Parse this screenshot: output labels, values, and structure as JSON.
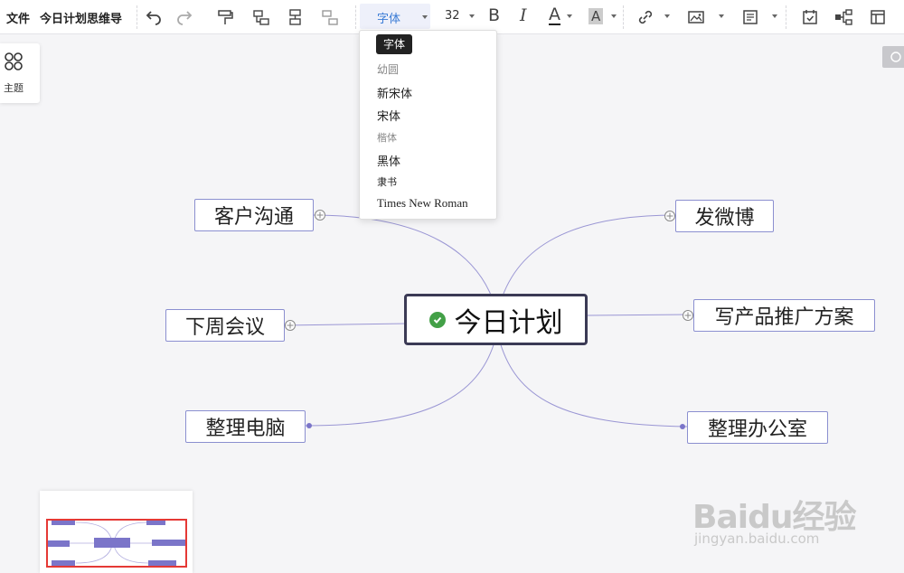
{
  "toolbar": {
    "file_menu": "文件",
    "doc_title": "今日计划思维导",
    "font_family": "字体",
    "font_size": "32",
    "bold_glyph": "B",
    "italic_glyph": "I",
    "font_color_glyph": "A",
    "highlight_glyph": "A"
  },
  "font_dropdown": {
    "tooltip": "字体",
    "options": [
      "幼圆",
      "新宋体",
      "宋体",
      "楷体",
      "黑体",
      "隶书",
      "Times New Roman"
    ]
  },
  "theme_panel": {
    "label": "主题"
  },
  "mindmap": {
    "center": "今日计划",
    "left": [
      "客户沟通",
      "下周会议",
      "整理电脑"
    ],
    "right": [
      "发微博",
      "写产品推广方案",
      "整理办公室"
    ]
  },
  "colors": {
    "accent": "#3a7bd5",
    "node_border": "#8b8fd0",
    "connector": "#9a96d4",
    "center_border": "#3b3a55",
    "check": "#43a047",
    "minimap_view": "#e53935"
  },
  "watermark": {
    "logo": "Baidu经验",
    "url": "jingyan.baidu.com"
  }
}
